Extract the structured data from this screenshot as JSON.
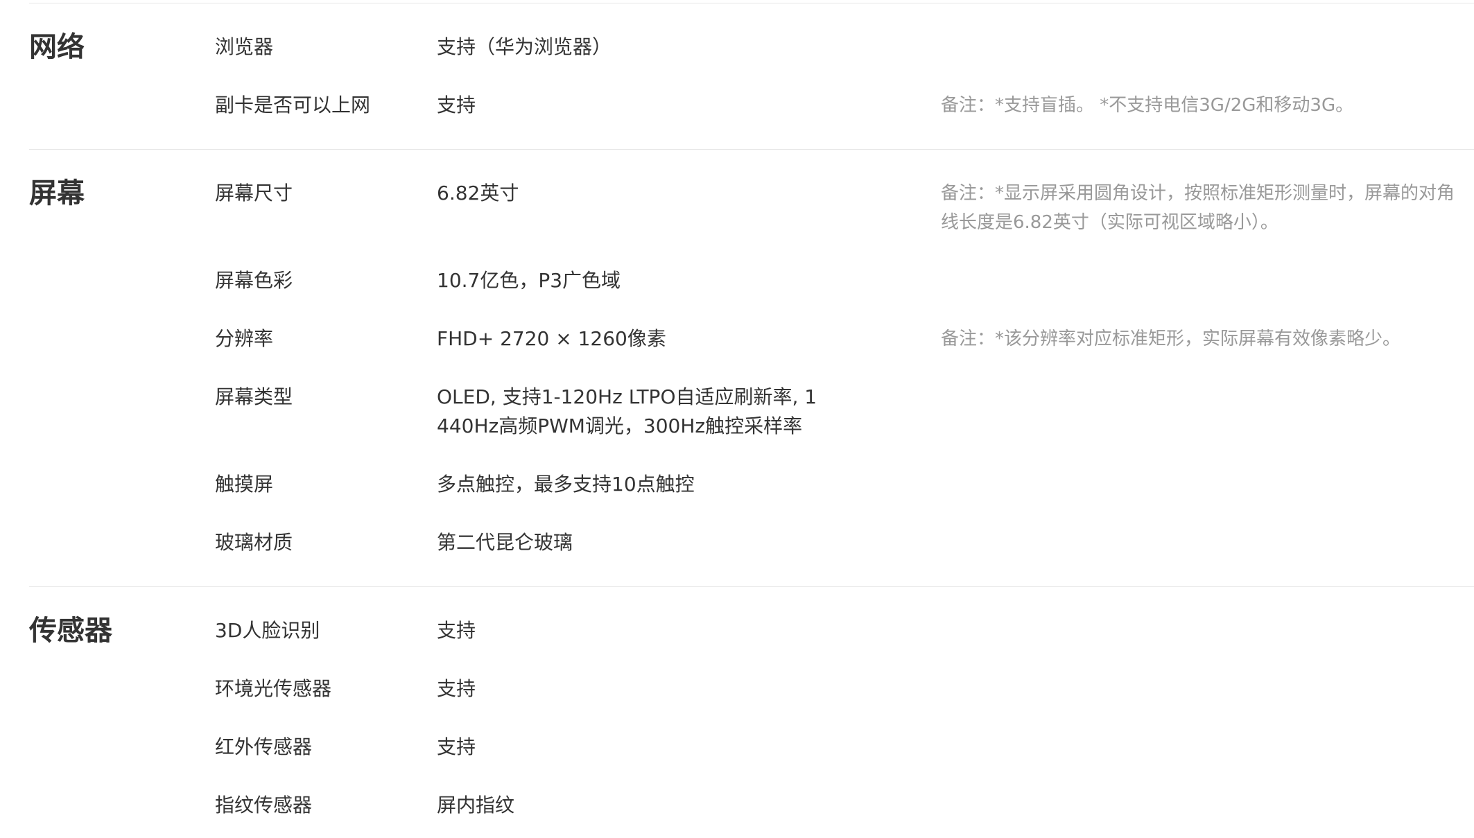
{
  "sections": [
    {
      "title": "网络",
      "rows": [
        {
          "label": "浏览器",
          "value": "支持（华为浏览器）"
        },
        {
          "label": "副卡是否可以上网",
          "value": "支持",
          "note": "备注：*支持盲插。 *不支持电信3G/2G和移动3G。"
        }
      ]
    },
    {
      "title": "屏幕",
      "rows": [
        {
          "label": "屏幕尺寸",
          "value": "6.82英寸",
          "note": "备注：*显示屏采用圆角设计，按照标准矩形测量时，屏幕的对角线长度是6.82英寸（实际可视区域略小）。"
        },
        {
          "label": "屏幕色彩",
          "value": "10.7亿色，P3广色域"
        },
        {
          "label": "分辨率",
          "value": "FHD+ 2720 × 1260像素",
          "note": "备注：*该分辨率对应标准矩形，实际屏幕有效像素略少。"
        },
        {
          "label": "屏幕类型",
          "value": "OLED, 支持1-120Hz LTPO自适应刷新率, 1440Hz高频PWM调光，300Hz触控采样率"
        },
        {
          "label": "触摸屏",
          "value": "多点触控，最多支持10点触控"
        },
        {
          "label": "玻璃材质",
          "value": "第二代昆仑玻璃"
        }
      ]
    },
    {
      "title": "传感器",
      "rows": [
        {
          "label": "3D人脸识别",
          "value": "支持"
        },
        {
          "label": "环境光传感器",
          "value": "支持"
        },
        {
          "label": "红外传感器",
          "value": "支持"
        },
        {
          "label": "指纹传感器",
          "value": "屏内指纹"
        }
      ]
    }
  ]
}
